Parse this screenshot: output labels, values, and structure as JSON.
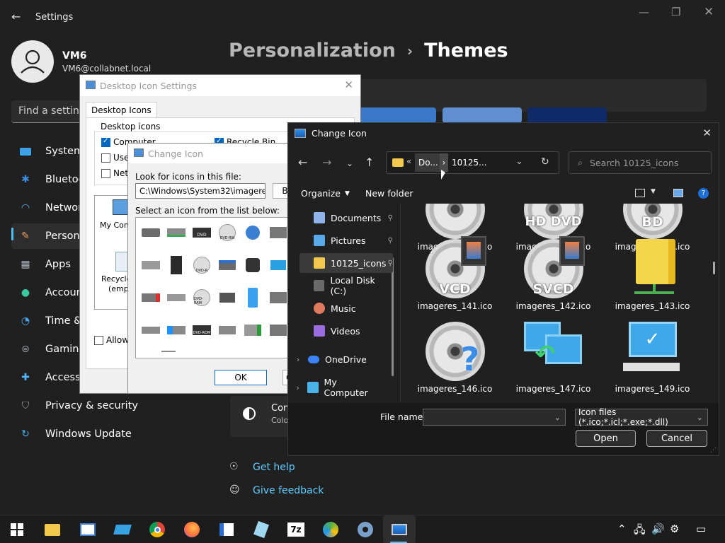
{
  "settings": {
    "title": "Settings",
    "user": {
      "name": "VM6",
      "email": "VM6@collabnet.local"
    },
    "search_placeholder": "Find a setting",
    "nav": [
      {
        "label": "System",
        "icon": "monitor-icon"
      },
      {
        "label": "Bluetooth & devices",
        "icon": "bluetooth-icon"
      },
      {
        "label": "Network & internet",
        "icon": "wifi-icon"
      },
      {
        "label": "Personalization",
        "icon": "brush-icon"
      },
      {
        "label": "Apps",
        "icon": "apps-icon"
      },
      {
        "label": "Accounts",
        "icon": "account-icon"
      },
      {
        "label": "Time & language",
        "icon": "clock-icon"
      },
      {
        "label": "Gaming",
        "icon": "gamepad-icon"
      },
      {
        "label": "Accessibility",
        "icon": "accessibility-icon"
      },
      {
        "label": "Privacy & security",
        "icon": "shield-icon"
      },
      {
        "label": "Windows Update",
        "icon": "update-icon"
      }
    ],
    "breadcrumb": {
      "parent": "Personalization",
      "current": "Themes"
    },
    "contrast_row": {
      "title": "Con",
      "sub": "Colo"
    },
    "links": {
      "help": "Get help",
      "feedback": "Give feedback"
    }
  },
  "desktop_icon_settings": {
    "title": "Desktop Icon Settings",
    "tab": "Desktop Icons",
    "group_label": "Desktop icons",
    "checkboxes": [
      {
        "label": "Computer",
        "checked": true
      },
      {
        "label": "Recycle Bin",
        "checked": true
      },
      {
        "label": "User",
        "checked": false
      },
      {
        "label": "Netw",
        "checked": false
      }
    ],
    "preview_icons": [
      {
        "label": "My Comp"
      },
      {
        "label": "Recycle"
      },
      {
        "label": "(empt"
      }
    ],
    "allow_label": "Allow t"
  },
  "change_icon_small": {
    "title": "Change Icon",
    "look_label": "Look for icons in this file:",
    "file_path": "C:\\Windows\\System32\\imageres.dll",
    "browse_label": "Br",
    "select_label": "Select an icon from the list below:",
    "grid_texts": [
      "DVD",
      "DVD-RW",
      "DVD-R",
      "DVD-RAM",
      "DVD-ROM"
    ],
    "ok_label": "OK",
    "cancel_label": "C"
  },
  "file_picker": {
    "title": "Change Icon",
    "address": {
      "seg1": "Do...",
      "seg2": "10125..."
    },
    "search_placeholder": "Search 10125_icons",
    "toolbar": {
      "organize": "Organize",
      "new_folder": "New folder"
    },
    "tree": [
      {
        "label": "Documents",
        "pinned": true,
        "color": "#8fb3e8"
      },
      {
        "label": "Pictures",
        "pinned": true,
        "color": "#59a8e8"
      },
      {
        "label": "10125_icons",
        "pinned": true,
        "color": "#f2c94c",
        "selected": true
      },
      {
        "label": "Local Disk (C:)",
        "pinned": false,
        "color": "#6a6a6a"
      },
      {
        "label": "Music",
        "pinned": false,
        "color": "#e07a5f"
      },
      {
        "label": "Videos",
        "pinned": false,
        "color": "#9b6ce0"
      },
      {
        "label": "OneDrive",
        "pinned": false,
        "color": "#3b82f6"
      },
      {
        "label": "My Computer",
        "pinned": false,
        "color": "#4ab3e8"
      }
    ],
    "files": [
      {
        "name": "imageres_137.ico",
        "overlay": ""
      },
      {
        "name": "imageres_139.ico",
        "overlay": "HD DVD"
      },
      {
        "name": "imageres_140.ico",
        "overlay": "BD"
      },
      {
        "name": "imageres_141.ico",
        "overlay": "VCD"
      },
      {
        "name": "imageres_142.ico",
        "overlay": "SVCD"
      },
      {
        "name": "imageres_143.ico",
        "overlay": ""
      },
      {
        "name": "imageres_146.ico",
        "overlay": ""
      },
      {
        "name": "imageres_147.ico",
        "overlay": ""
      },
      {
        "name": "imageres_149.ico",
        "overlay": ""
      }
    ],
    "file_name_label": "File name:",
    "file_name_value": "",
    "filter": "Icon files (*.ico;*.icl;*.exe;*.dll)",
    "open_label": "Open",
    "cancel_label": "Cancel"
  },
  "taskbar": {
    "apps": [
      "start-icon",
      "file-explorer-icon",
      "task-manager-icon",
      "app-icon",
      "chrome-icon",
      "firefox-icon",
      "notepad-icon",
      "notepad-app-icon",
      "7zip-icon",
      "photo-icon",
      "settings-icon",
      "display-icon"
    ],
    "seven_zip_text": "7z"
  }
}
